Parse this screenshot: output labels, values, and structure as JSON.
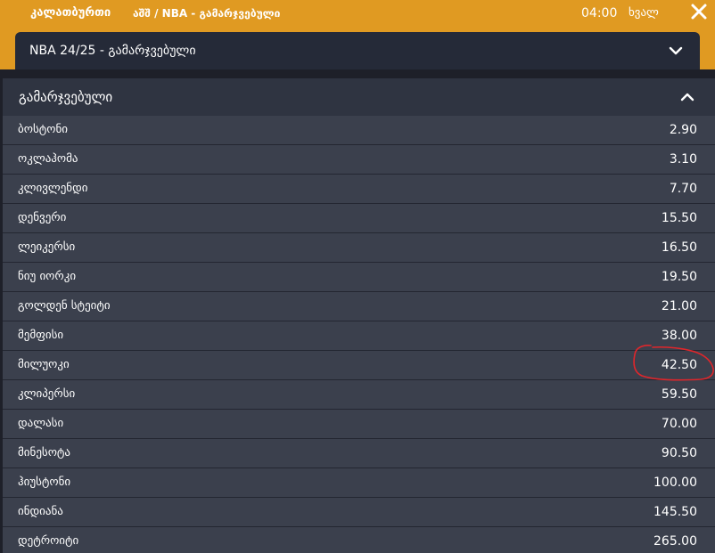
{
  "header": {
    "sport": "კალათბურთი",
    "breadcrumb": "აშშ / NBA - გამარჯვებული",
    "time": "04:00",
    "day": "ხვალ",
    "close_icon": "close-icon"
  },
  "league_select": {
    "label": "NBA 24/25 - გამარჯვებული",
    "icon": "chevron-down-icon"
  },
  "market": {
    "title": "გამარჯვებული",
    "icon": "chevron-up-icon"
  },
  "odds": [
    {
      "team": "ბოსტონი",
      "odd": "2.90"
    },
    {
      "team": "ოკლაჰომა",
      "odd": "3.10"
    },
    {
      "team": "კლივლენდი",
      "odd": "7.70"
    },
    {
      "team": "დენვერი",
      "odd": "15.50"
    },
    {
      "team": "ლეიკერსი",
      "odd": "16.50"
    },
    {
      "team": "ნიუ იორკი",
      "odd": "19.50"
    },
    {
      "team": "გოლდენ სტეიტი",
      "odd": "21.00"
    },
    {
      "team": "მემფისი",
      "odd": "38.00"
    },
    {
      "team": "მილუოკი",
      "odd": "42.50"
    },
    {
      "team": "კლიპერსი",
      "odd": "59.50"
    },
    {
      "team": "დალასი",
      "odd": "70.00"
    },
    {
      "team": "მინესოტა",
      "odd": "90.50"
    },
    {
      "team": "ჰიუსტონი",
      "odd": "100.00"
    },
    {
      "team": "ინდიანა",
      "odd": "145.50"
    },
    {
      "team": "დეტროიტი",
      "odd": "265.00"
    }
  ],
  "colors": {
    "header_bg": "#e09a22",
    "row_bg": "#3b404d",
    "select_bg": "#252a38",
    "market_header_bg": "#2f3441",
    "annotation": "#e0262b"
  }
}
